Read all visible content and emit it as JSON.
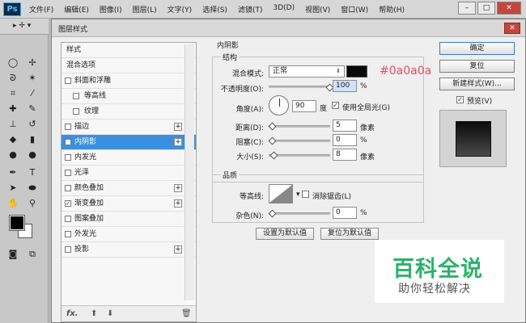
{
  "app": {
    "logo": "Ps",
    "menu": [
      "文件(F)",
      "编辑(E)",
      "图像(I)",
      "图层(L)",
      "文字(Y)",
      "选择(S)",
      "滤镜(T)",
      "3D(D)",
      "视图(V)",
      "窗口(W)",
      "帮助(H)"
    ],
    "window_buttons": {
      "minimize": "–",
      "maximize": "□",
      "close": "✕"
    }
  },
  "tools": {
    "option_label": "▸ ✢ ▾"
  },
  "dialog": {
    "title": "图层样式",
    "close": "✕",
    "style_list": [
      {
        "label": "样式",
        "checkbox": false,
        "plus": false,
        "checked": false
      },
      {
        "label": "混合选项",
        "checkbox": false,
        "plus": false,
        "checked": false
      },
      {
        "label": "斜面和浮雕",
        "checkbox": true,
        "plus": false,
        "checked": false
      },
      {
        "label": "等高线",
        "checkbox": true,
        "plus": false,
        "checked": false,
        "indent": true
      },
      {
        "label": "纹理",
        "checkbox": true,
        "plus": false,
        "checked": false,
        "indent": true
      },
      {
        "label": "描边",
        "checkbox": true,
        "plus": true,
        "checked": false
      },
      {
        "label": "内阴影",
        "checkbox": true,
        "plus": true,
        "checked": true,
        "selected": true
      },
      {
        "label": "内发光",
        "checkbox": true,
        "plus": false,
        "checked": false
      },
      {
        "label": "光泽",
        "checkbox": true,
        "plus": false,
        "checked": false
      },
      {
        "label": "颜色叠加",
        "checkbox": true,
        "plus": true,
        "checked": false
      },
      {
        "label": "渐变叠加",
        "checkbox": true,
        "plus": true,
        "checked": true
      },
      {
        "label": "图案叠加",
        "checkbox": true,
        "plus": false,
        "checked": false
      },
      {
        "label": "外发光",
        "checkbox": true,
        "plus": false,
        "checked": false
      },
      {
        "label": "投影",
        "checkbox": true,
        "plus": true,
        "checked": false
      }
    ],
    "list_footer": {
      "fx": "fx.",
      "up": "⬆",
      "down": "⬇",
      "trash": "🗑"
    },
    "section_title": "内阴影",
    "structure": {
      "group_label": "结构",
      "blend_mode_label": "混合模式:",
      "blend_mode_value": "正常",
      "color_hex_note": "#0a0a0a",
      "opacity_label": "不透明度(O):",
      "opacity_value": "100",
      "opacity_unit": "%",
      "opacity_level": 1.0,
      "angle_label": "角度(A):",
      "angle_value": "90",
      "angle_unit": "度",
      "global_light_label": "使用全局光(G)",
      "global_light_checked": true,
      "distance_label": "距离(D):",
      "distance_value": "5",
      "distance_unit": "像素",
      "choke_label": "阻塞(C):",
      "choke_value": "0",
      "choke_unit": "%",
      "size_label": "大小(S):",
      "size_value": "8",
      "size_unit": "像素"
    },
    "quality": {
      "group_label": "品质",
      "contour_label": "等高线:",
      "antialias_label": "消除锯齿(L)",
      "antialias_checked": false,
      "noise_label": "杂色(N):",
      "noise_value": "0",
      "noise_unit": "%"
    },
    "buttons": {
      "make_default": "设置为默认值",
      "reset_default": "复位为默认值"
    },
    "right": {
      "ok": "确定",
      "reset": "复位",
      "new_style": "新建样式(W)...",
      "preview_label": "预览(V)",
      "preview_checked": true
    }
  },
  "watermark": {
    "title": "百科全说",
    "subtitle": "助你轻松解决"
  },
  "colors": {
    "selection": "#3b8fe0",
    "shadow_color": "#0a0a0a",
    "hex_note_color": "#e04f62",
    "watermark_green": "#2bb36a"
  }
}
